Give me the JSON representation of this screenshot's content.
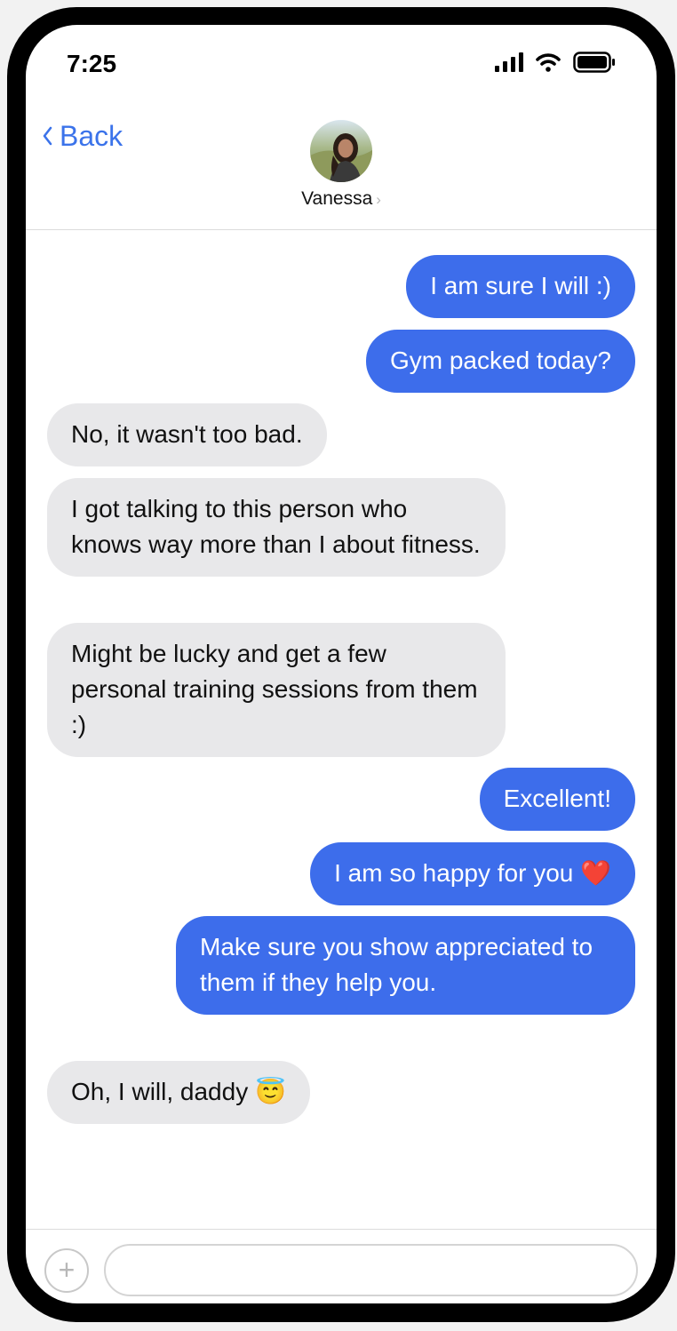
{
  "status_bar": {
    "time": "7:25",
    "icons": [
      "cellular-signal-icon",
      "wifi-icon",
      "battery-icon"
    ]
  },
  "header": {
    "back_label": "Back",
    "contact_name": "Vanessa",
    "avatar_icon": "contact-photo"
  },
  "messages": [
    {
      "direction": "outgoing",
      "text": "I am sure I will :)"
    },
    {
      "direction": "outgoing",
      "text": "Gym packed today?"
    },
    {
      "direction": "incoming",
      "text": "No, it wasn't too bad."
    },
    {
      "direction": "incoming",
      "text": "I got talking to this person who knows way more than I about fitness."
    },
    {
      "direction": "incoming",
      "text": "Might be lucky and get a few personal training sessions from them :)"
    },
    {
      "direction": "outgoing",
      "text": "Excellent!"
    },
    {
      "direction": "outgoing",
      "text": "I am so happy for you ❤️"
    },
    {
      "direction": "outgoing",
      "text": "Make sure you show appreciated to them if they help you."
    },
    {
      "direction": "incoming",
      "text": "Oh, I will, daddy 😇"
    }
  ],
  "composer": {
    "plus_label": "+",
    "input_value": "",
    "input_placeholder": ""
  },
  "colors": {
    "outgoing_bubble": "#3d6deb",
    "incoming_bubble": "#e8e8ea",
    "accent": "#3b73ea"
  }
}
